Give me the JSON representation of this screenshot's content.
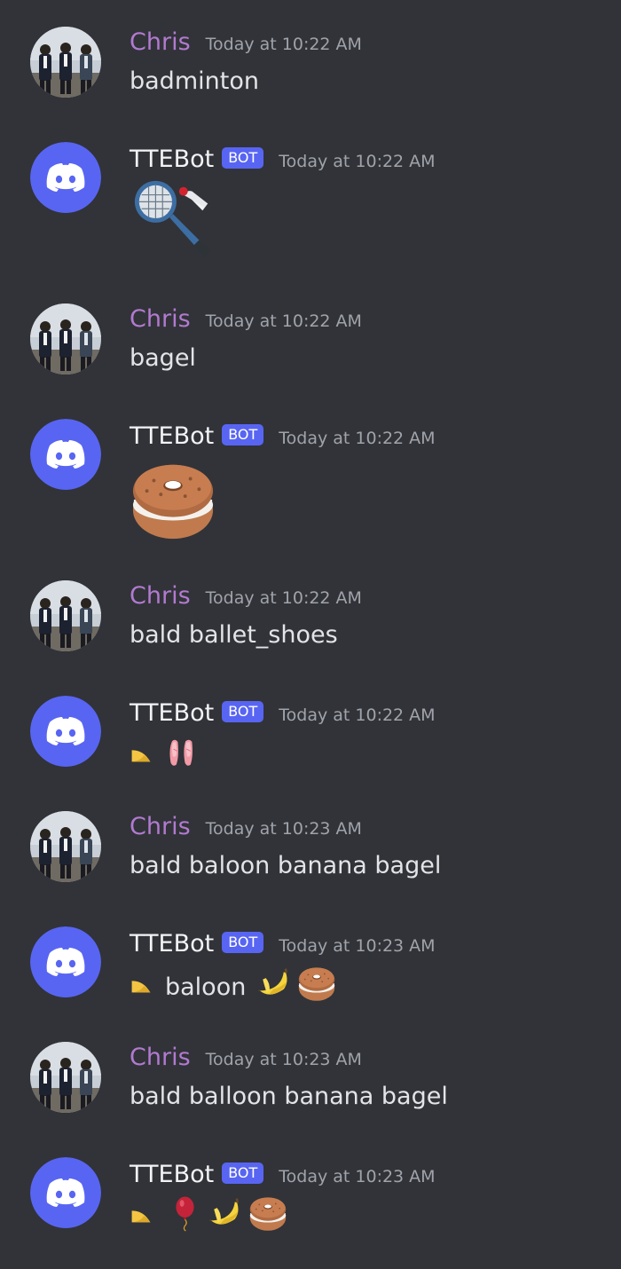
{
  "messages": [
    {
      "author": "Chris",
      "time": "Today at 10:22 AM",
      "text": "badminton"
    },
    {
      "author": "TTEBot",
      "badge": "BOT",
      "time": "Today at 10:22 AM",
      "emojis": [
        "badminton-icon"
      ]
    },
    {
      "author": "Chris",
      "time": "Today at 10:22 AM",
      "text": "bagel"
    },
    {
      "author": "TTEBot",
      "badge": "BOT",
      "time": "Today at 10:22 AM",
      "emojis": [
        "bagel-icon"
      ]
    },
    {
      "author": "Chris",
      "time": "Today at 10:22 AM",
      "text": "bald ballet_shoes"
    },
    {
      "author": "TTEBot",
      "badge": "BOT",
      "time": "Today at 10:22 AM",
      "emojis": [
        "bald-icon",
        "ballet-shoes-icon"
      ]
    },
    {
      "author": "Chris",
      "time": "Today at 10:23 AM",
      "text": "bald baloon banana bagel"
    },
    {
      "author": "TTEBot",
      "badge": "BOT",
      "time": "Today at 10:23 AM",
      "text": "baloon",
      "emojis": [
        "bald-icon",
        "banana-icon",
        "bagel-icon"
      ]
    },
    {
      "author": "Chris",
      "time": "Today at 10:23 AM",
      "text": "bald balloon banana bagel"
    },
    {
      "author": "TTEBot",
      "badge": "BOT",
      "time": "Today at 10:23 AM",
      "emojis": [
        "bald-icon",
        "balloon-icon",
        "banana-icon",
        "bagel-icon"
      ]
    }
  ],
  "colors": {
    "background": "#313338",
    "chris_name": "#b27ad0",
    "bot_badge": "#5865f2",
    "discord_blurple": "#5865f2"
  }
}
